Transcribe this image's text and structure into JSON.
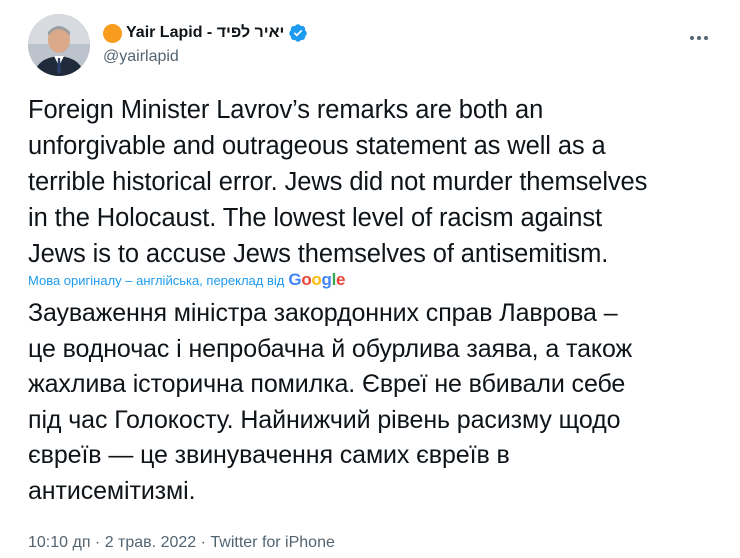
{
  "author": {
    "display_name": "Yair Lapid - יאיר לפיד",
    "handle": "@yairlapid",
    "emoji_icon": "orange-circle-icon",
    "verified_icon": "verified-badge-icon",
    "verified_color": "#1d9bf0"
  },
  "menu": {
    "icon": "more-options-icon"
  },
  "tweet": {
    "text": "Foreign Minister Lavrov’s remarks are both an\nunforgivable and outrageous statement as well as a\nterrible historical error. Jews did not murder themselves\nin the Holocaust. The lowest level of racism against\nJews is to accuse Jews themselves of antisemitism.",
    "translation_label": "Мова оригіналу – англійська, переклад від",
    "translation_provider": "Google",
    "translated_text": "Зауваження міністра закордонних справ Лаврова –\nце водночас і непробачна й обурлива заява, а також\nжахлива історична помилка. Євреї не вбивали себе\nпід час Голокосту. Найнижчий рівень расизму щодо\nєвреїв — це звинувачення самих євреїв в\nантисемітизмі."
  },
  "meta": {
    "time": "10:10 дп",
    "separator": " · ",
    "date": "2 трав. 2022",
    "source": "Twitter for iPhone"
  },
  "colors": {
    "text": "#0f1419",
    "secondary": "#536471",
    "link": "#1d9bf0"
  }
}
